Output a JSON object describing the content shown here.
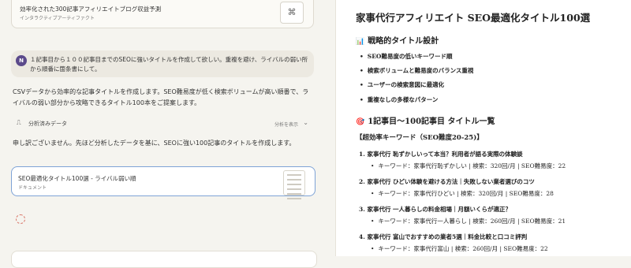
{
  "chat": {
    "artifact_top": {
      "title": "効率化された300記事アフィリエイトブログ収益予測",
      "type": "インタラクティブアーティファクト"
    },
    "user_message": {
      "avatar": "N",
      "text": "１記事目から１００記事目までのSEOに強いタイトルを作成して欲しい。重複を避け、ライバルの弱い所から順番に箇条書にして。"
    },
    "reply1": "CSVデータから効率的な記事タイトルを作成します。SEO難易度が低く検索ボリュームが高い順番で、ライバルの弱い部分から攻略できるタイトル100本をご提案します。",
    "analysis": {
      "label": "分析済みデータ",
      "show": "分析を表示"
    },
    "reply2": "申し訳ございません。先ほど分析したデータを基に、SEOに強い100記事のタイトルを作成します。",
    "artifact2": {
      "title": "SEO最適化タイトル100選 - ライバル弱い順",
      "type": "ドキュメント"
    }
  },
  "doc": {
    "title": "家事代行アフィリエイト SEO最適化タイトル100選",
    "section1": {
      "icon": "📊",
      "heading": "戦略的タイトル設計"
    },
    "bullets": [
      "SEO難易度の低いキーワード順",
      "検索ボリュームと難易度のバランス重視",
      "ユーザーの検索意図に最適化",
      "重複なしの多様なパターン"
    ],
    "section2": {
      "icon": "🎯",
      "heading": "1記事目〜100記事目 タイトル一覧"
    },
    "bracket": "【超効率キーワード（SEO難度20-25)】",
    "items": [
      {
        "title": "1. 家事代行 恥ずかしいって本当？利用者が語る実際の体験談",
        "detail": "キーワード：家事代行恥ずかしい | 検索：320回/月 | SEO難易度：22"
      },
      {
        "title": "2. 家事代行 ひどい体験を避ける方法｜失敗しない業者選びのコツ",
        "detail": "キーワード：家事代行ひどい | 検索：320回/月 | SEO難易度：28"
      },
      {
        "title": "3. 家事代行 一人暮らしの料金相場｜月額いくらが適正？",
        "detail": "キーワード：家事代行一人暮らし | 検索：260回/月 | SEO難易度：21"
      },
      {
        "title": "4. 家事代行 富山でおすすめの業者5選｜料金比較と口コミ評判",
        "detail": "キーワード：家事代行富山 | 検索：260回/月 | SEO難易度：22"
      }
    ]
  }
}
